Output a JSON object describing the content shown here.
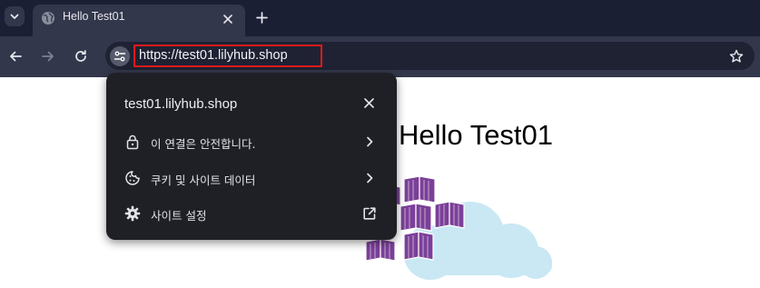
{
  "browser": {
    "tab": {
      "title": "Hello Test01"
    },
    "address_bar": {
      "url": "https://test01.lilyhub.shop"
    }
  },
  "page": {
    "heading": "Hello Test01",
    "illustration": "azure-kubernetes-cloud-logo"
  },
  "site_info_popup": {
    "domain": "test01.lilyhub.shop",
    "items": [
      {
        "label": "이 연결은 안전합니다.",
        "icon": "lock-icon",
        "trailing": "chevron-right-icon"
      },
      {
        "label": "쿠키 및 사이트 데이터",
        "icon": "cookie-icon",
        "trailing": "chevron-right-icon"
      },
      {
        "label": "사이트 설정",
        "icon": "gear-icon",
        "trailing": "open-in-new-icon"
      }
    ]
  },
  "colors": {
    "tabstrip_bg": "#1b1f34",
    "toolbar_bg": "#33374b",
    "popup_bg": "#1f2026",
    "highlight_border": "#e11a1a",
    "logo_purple": "#7b3f98",
    "cloud_blue": "#c9e8f4"
  }
}
